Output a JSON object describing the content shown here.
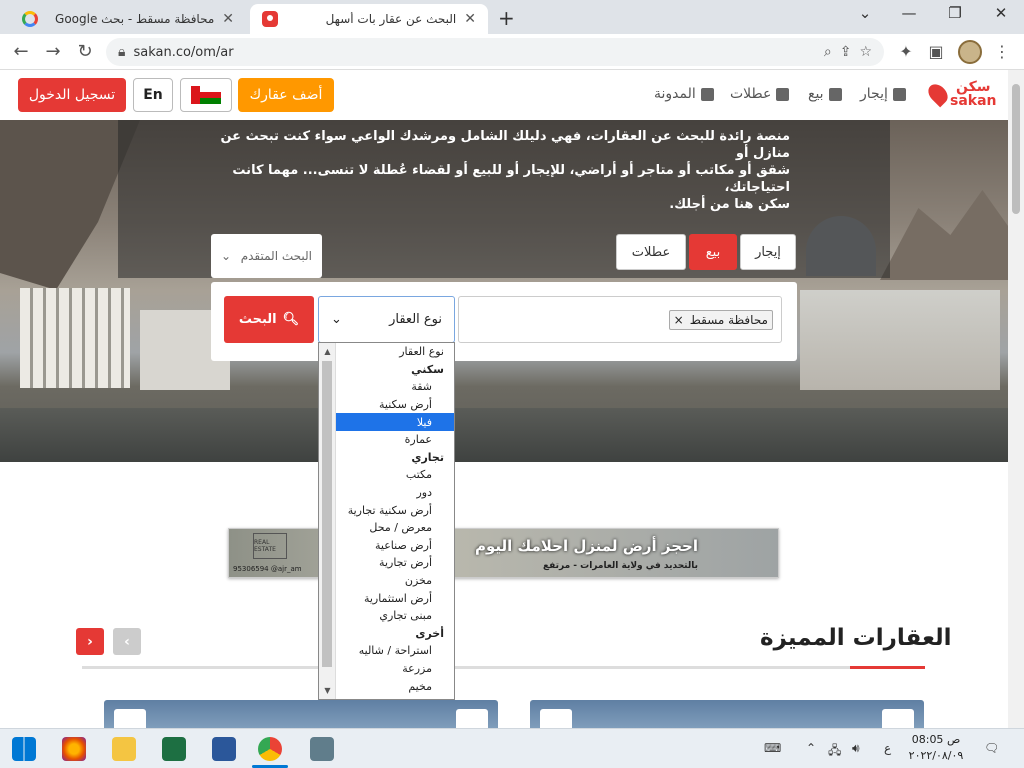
{
  "browser": {
    "tabs": [
      {
        "title": "محافظة مسقط - بحث Google",
        "icon": "google-icon"
      },
      {
        "title": "البحث عن عقار بات أسهل",
        "icon": "sakan-pin-icon"
      }
    ],
    "new_tab": "+",
    "url": "sakan.co/om/ar",
    "window_controls": {
      "minimize": "⌄",
      "restore": "—",
      "maximize": "❐",
      "close": "✕"
    }
  },
  "site": {
    "logo": {
      "arabic": "سكن",
      "latin": "sakan"
    },
    "nav": [
      {
        "label": "إيجار",
        "icon": "building-icon"
      },
      {
        "label": "بيع",
        "icon": "home-icon"
      },
      {
        "label": "عطلات",
        "icon": "bed-icon"
      },
      {
        "label": "المدونة",
        "icon": "blog-icon"
      }
    ],
    "add_property": "أضف عقارك",
    "lang": "En",
    "login": "تسجيل الدخول"
  },
  "hero": {
    "line1": "منصة رائدة للبحث عن العقارات، فهي دليلك الشامل ومرشدك الواعي سواء كنت تبحث عن منازل أو",
    "line2": "شقق أو مكاتب أو متاجر أو أراضي، للإيجار أو للبيع أو لقضاء عُطلة لا تنسى... مهما كانت احتياجاتك،",
    "line3": "سكن هنا من أجلك."
  },
  "search": {
    "tabs": [
      "إيجار",
      "بيع",
      "عطلات"
    ],
    "active_tab": "بيع",
    "advanced": "البحث المتقدم",
    "location_chip": "محافظة مسقط",
    "chip_remove": "×",
    "property_type": "نوع العقار",
    "button": "البحث"
  },
  "dropdown": {
    "options": [
      {
        "label": "نوع العقار",
        "kind": "first"
      },
      {
        "label": "سكني",
        "kind": "group"
      },
      {
        "label": "شقة",
        "kind": "item"
      },
      {
        "label": "أرض سكنية",
        "kind": "item"
      },
      {
        "label": "فيلا",
        "kind": "selected"
      },
      {
        "label": "عمارة",
        "kind": "item"
      },
      {
        "label": "تجاري",
        "kind": "group"
      },
      {
        "label": "مكتب",
        "kind": "item"
      },
      {
        "label": "دور",
        "kind": "item"
      },
      {
        "label": "أرض سكنية تجارية",
        "kind": "item"
      },
      {
        "label": "معرض / محل",
        "kind": "item"
      },
      {
        "label": "أرض صناعية",
        "kind": "item"
      },
      {
        "label": "أرض تجارية",
        "kind": "item"
      },
      {
        "label": "مخزن",
        "kind": "item"
      },
      {
        "label": "أرض استثمارية",
        "kind": "item"
      },
      {
        "label": "مبنى تجاري",
        "kind": "item"
      },
      {
        "label": "أخرى",
        "kind": "group"
      },
      {
        "label": "استراحة / شاليه",
        "kind": "item"
      },
      {
        "label": "مزرعة",
        "kind": "item"
      },
      {
        "label": "مخيم",
        "kind": "item"
      }
    ]
  },
  "banner": {
    "headline": "احجز أرض لمنزل احلامك اليوم",
    "sub": "بالتحديد في ولاية العامرات - مرتفع",
    "contact": "95306594 @ajr_am",
    "badge": "REAL ESTATE"
  },
  "featured": {
    "title": "العقارات المميزة"
  },
  "taskbar": {
    "time": "08:05 ص",
    "date": "٢٠٢٢/٠٨/٠٩",
    "lang": "ع"
  },
  "colors": {
    "brand": "#e53935",
    "accent": "#ff9800",
    "selected": "#1e73e8"
  }
}
